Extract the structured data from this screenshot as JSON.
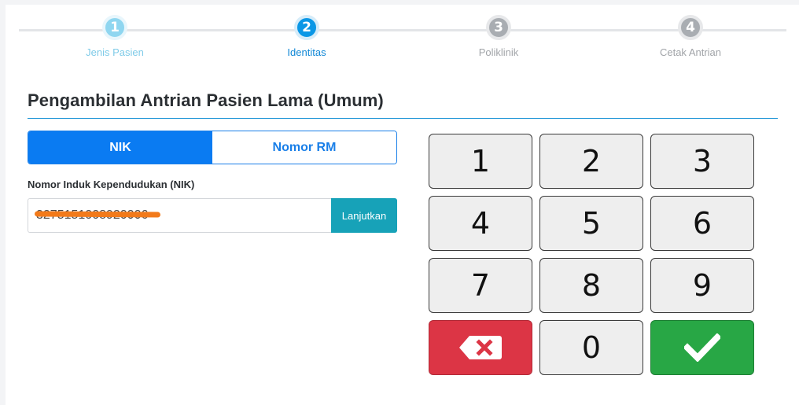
{
  "stepper": {
    "steps": [
      {
        "number": "1",
        "label": "Jenis Pasien",
        "state": "done"
      },
      {
        "number": "2",
        "label": "Identitas",
        "state": "active"
      },
      {
        "number": "3",
        "label": "Poliklinik",
        "state": "todo"
      },
      {
        "number": "4",
        "label": "Cetak Antrian",
        "state": "todo"
      }
    ]
  },
  "page": {
    "title": "Pengambilan Antrian Pasien Lama (Umum)"
  },
  "toggle": {
    "nik_label": "NIK",
    "rm_label": "Nomor RM",
    "selected": "NIK"
  },
  "form": {
    "field_label": "Nomor Induk Kependudukan (NIK)",
    "nik_value": "3275151008920006",
    "submit_label": "Lanjutkan"
  },
  "keypad": {
    "keys": [
      "1",
      "2",
      "3",
      "4",
      "5",
      "6",
      "7",
      "8",
      "9"
    ],
    "zero": "0",
    "delete_icon": "backspace-x-icon",
    "confirm_icon": "checkmark-icon"
  },
  "colors": {
    "primary": "#0a7bf2",
    "info": "#17a2b8",
    "danger": "#dc3545",
    "success": "#28a745",
    "active_step": "#0a97e6"
  }
}
